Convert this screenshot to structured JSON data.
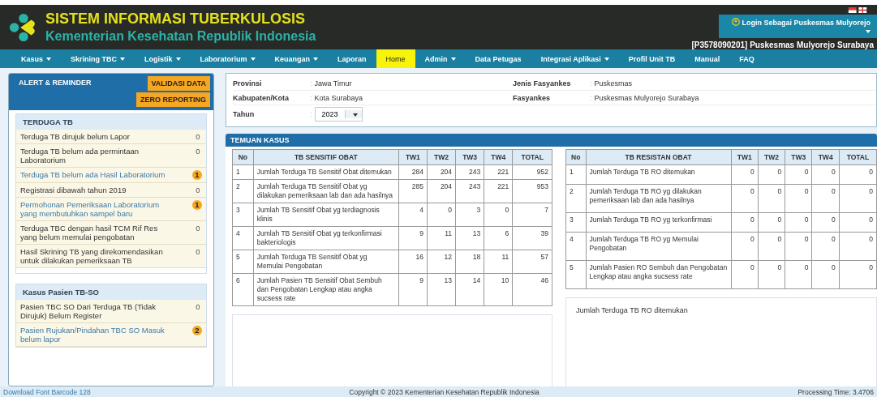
{
  "header": {
    "title": "SISTEM INFORMASI TUBERKULOSIS",
    "subtitle": "Kementerian Kesehatan Republik Indonesia",
    "login": "Login Sebagai Puskesmas Mulyorejo",
    "facility": "[P3578090201] Puskesmas Mulyorejo Surabaya"
  },
  "nav": [
    {
      "label": "Kasus",
      "dropdown": true,
      "selected": false
    },
    {
      "label": "Skrining TBC",
      "dropdown": true,
      "selected": false
    },
    {
      "label": "Logistik",
      "dropdown": true,
      "selected": false
    },
    {
      "label": "Laboratorium",
      "dropdown": true,
      "selected": false
    },
    {
      "label": "Keuangan",
      "dropdown": true,
      "selected": false
    },
    {
      "label": "Laporan",
      "dropdown": false,
      "selected": false
    },
    {
      "label": "Home",
      "dropdown": false,
      "selected": true
    },
    {
      "label": "Admin",
      "dropdown": true,
      "selected": false
    },
    {
      "label": "Data Petugas",
      "dropdown": false,
      "selected": false
    },
    {
      "label": "Integrasi Aplikasi",
      "dropdown": true,
      "selected": false
    },
    {
      "label": "Profil Unit TB",
      "dropdown": false,
      "selected": false
    },
    {
      "label": "Manual",
      "dropdown": false,
      "selected": false
    },
    {
      "label": "FAQ",
      "dropdown": false,
      "selected": false
    }
  ],
  "sidebar": {
    "title": "ALERT & REMINDER",
    "buttons": [
      "VALIDASI DATA",
      "ZERO REPORTING"
    ],
    "groups": [
      {
        "title": "TERDUGA TB",
        "items": [
          {
            "text": "Terduga TB dirujuk belum Lapor",
            "count": "0",
            "alert": false
          },
          {
            "text": "Terduga TB belum ada permintaan Laboratorium",
            "count": "0",
            "alert": false
          },
          {
            "text": "Terduga TB belum ada Hasil Laboratorium",
            "count": "1",
            "alert": true
          },
          {
            "text": "Registrasi dibawah tahun 2019",
            "count": "0",
            "alert": false
          },
          {
            "text": "Permohonan Pemeriksaan Laboratorium yang membutuhkan sampel baru",
            "count": "1",
            "alert": true
          },
          {
            "text": "Terduga TBC dengan hasil TCM Rif Res yang belum memulai pengobatan",
            "count": "0",
            "alert": false
          },
          {
            "text": "Hasil Skrining TB yang direkomendasikan untuk dilakukan pemeriksaan TB",
            "count": "0",
            "alert": false
          }
        ]
      },
      {
        "title": "Kasus Pasien TB-SO",
        "items": [
          {
            "text": "Pasien TBC SO Dari Terduga TB (Tidak Dirujuk) Belum Register",
            "count": "0",
            "alert": false
          },
          {
            "text": "Pasien Rujukan/Pindahan TBC SO Masuk belum lapor",
            "count": "2",
            "alert": true
          }
        ]
      }
    ]
  },
  "info": {
    "left": [
      {
        "label": "Provinsi",
        "value": "Jawa Timur"
      },
      {
        "label": "Kabupaten/Kota",
        "value": "Kota Surabaya"
      }
    ],
    "right": [
      {
        "label": "Jenis Fasyankes",
        "value": "Puskesmas"
      },
      {
        "label": "Fasyankes",
        "value": "Puskesmas Mulyorejo Surabaya"
      }
    ],
    "separator": ":",
    "year_label": "Tahun",
    "year": "2023"
  },
  "temuan": {
    "title": "TEMUAN KASUS",
    "tables": [
      {
        "columns": [
          "No",
          "TB SENSITIF OBAT",
          "TW1",
          "TW2",
          "TW3",
          "TW4",
          "TOTAL"
        ],
        "rows": [
          [
            "1",
            "Jumlah Terduga TB Sensitif Obat ditemukan",
            "284",
            "204",
            "243",
            "221",
            "952"
          ],
          [
            "2",
            "Jumlah Terduga TB Sensitif Obat yg dilakukan pemeriksaan lab dan ada hasilnya",
            "285",
            "204",
            "243",
            "221",
            "953"
          ],
          [
            "3",
            "Jumlah TB Sensitif Obat yg terdiagnosis klinis",
            "4",
            "0",
            "3",
            "0",
            "7"
          ],
          [
            "4",
            "Jumlah TB Sensitif Obat yg terkonfirmasi bakteriologis",
            "9",
            "11",
            "13",
            "6",
            "39"
          ],
          [
            "5",
            "Jumlah Terduga TB Sensitif Obat yg Memulai Pengobatan",
            "16",
            "12",
            "18",
            "11",
            "57"
          ],
          [
            "6",
            "Jumlah Pasien TB Sensitif Obat Sembuh dan Pengobatan Lengkap atau angka sucsess rate",
            "9",
            "13",
            "14",
            "10",
            "46"
          ]
        ]
      },
      {
        "columns": [
          "No",
          "TB RESISTAN OBAT",
          "TW1",
          "TW2",
          "TW3",
          "TW4",
          "TOTAL"
        ],
        "rows": [
          [
            "1",
            "Jumlah Terduga TB RO ditemukan",
            "0",
            "0",
            "0",
            "0",
            "0"
          ],
          [
            "2",
            "Jumlah Terduga TB RO yg dilakukan pemeriksaan lab dan ada hasilnya",
            "0",
            "0",
            "0",
            "0",
            "0"
          ],
          [
            "3",
            "Jumlah Terduga TB RO yg terkonfirmasi",
            "0",
            "0",
            "0",
            "0",
            "0"
          ],
          [
            "4",
            "Jumlah Terduga TB RO yg Memulai Pengobatan",
            "0",
            "0",
            "0",
            "0",
            "0"
          ],
          [
            "5",
            "Jumlah Pasien RO Sembuh dan Pengobatan Lengkap atau angka sucsess rate",
            "0",
            "0",
            "0",
            "0",
            "0"
          ]
        ]
      }
    ],
    "chart_title": "Jumlah Terduga TB RO ditemukan"
  },
  "footer": {
    "left": "Download Font Barcode 128",
    "center": "Copyright © 2023 Kementerian Kesehatan Republik Indonesia",
    "right": "Processing Time: 3.4706"
  }
}
